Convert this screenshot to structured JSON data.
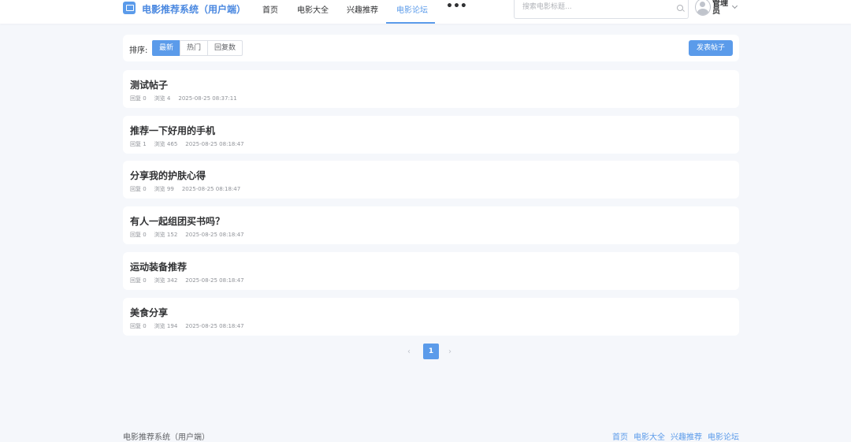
{
  "header": {
    "brand": "电影推荐系统（用户端）",
    "nav": [
      "首页",
      "电影大全",
      "兴趣推荐",
      "电影论坛"
    ],
    "active_nav": "电影论坛",
    "more": "•••",
    "search_placeholder": "搜索电影标题...",
    "username": "管理员"
  },
  "sort": {
    "label": "排序:",
    "options": [
      "最新",
      "热门",
      "回复数"
    ],
    "active": "最新"
  },
  "post_button": "发表帖子",
  "posts": [
    {
      "title": "测试帖子",
      "replies": "回复 0",
      "views": "浏览 4",
      "time": "2025-08-25 08:37:11"
    },
    {
      "title": "推荐一下好用的手机",
      "replies": "回复 1",
      "views": "浏览 465",
      "time": "2025-08-25 08:18:47"
    },
    {
      "title": "分享我的护肤心得",
      "replies": "回复 0",
      "views": "浏览 99",
      "time": "2025-08-25 08:18:47"
    },
    {
      "title": "有人一起组团买书吗？",
      "replies": "回复 0",
      "views": "浏览 152",
      "time": "2025-08-25 08:18:47"
    },
    {
      "title": "运动装备推荐",
      "replies": "回复 0",
      "views": "浏览 342",
      "time": "2025-08-25 08:18:47"
    },
    {
      "title": "美食分享",
      "replies": "回复 0",
      "views": "浏览 194",
      "time": "2025-08-25 08:18:47"
    }
  ],
  "pagination": {
    "prev": "‹",
    "current": "1",
    "next": "›"
  },
  "footer": {
    "copyright": "电影推荐系统（用户端）",
    "links": [
      "首页",
      "电影大全",
      "兴趣推荐",
      "电影论坛"
    ]
  },
  "colors": {
    "accent": "#5b9bea",
    "background": "#f5f7fb"
  }
}
